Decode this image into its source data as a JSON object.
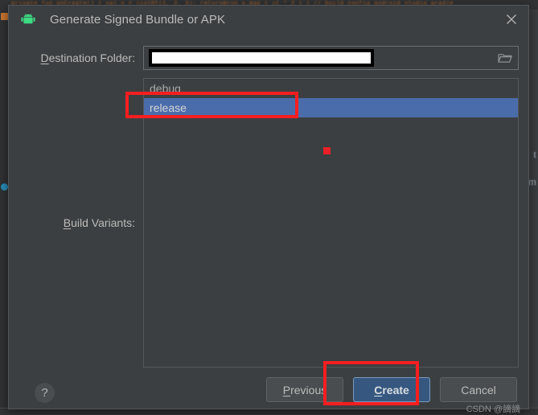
{
  "background": {
    "code_line": "private fun onCreate() { val x = listOf(1, 2, 3); return@run x.map { it * 2 } } // build config android studio gradle",
    "right_text_1": "t",
    "right_text_2": "m"
  },
  "dialog": {
    "title": "Generate Signed Bundle or APK",
    "app_icon": "android-robot-icon",
    "close_icon": "close-icon",
    "destination": {
      "label_prefix": "D",
      "label_rest": "estination Folder:",
      "value": "",
      "placeholder": "",
      "browse_icon": "folder-icon"
    },
    "build_variants": {
      "label_prefix": "B",
      "label_rest": "uild Variants:",
      "items": [
        {
          "label": "debug",
          "selected": false
        },
        {
          "label": "release",
          "selected": true
        }
      ]
    },
    "footer": {
      "help_label": "?",
      "previous_prefix": "P",
      "previous_rest": "revious",
      "create_prefix": "C",
      "create_rest": "reate",
      "cancel_label": "Cancel",
      "watermark": "CSDN @謫謫"
    }
  },
  "colors": {
    "dialog_bg": "#3c3f41",
    "selection_blue": "#4b6cab",
    "primary_button": "#365880",
    "annotation_red": "#f61e20",
    "android_green": "#3ddc84"
  }
}
